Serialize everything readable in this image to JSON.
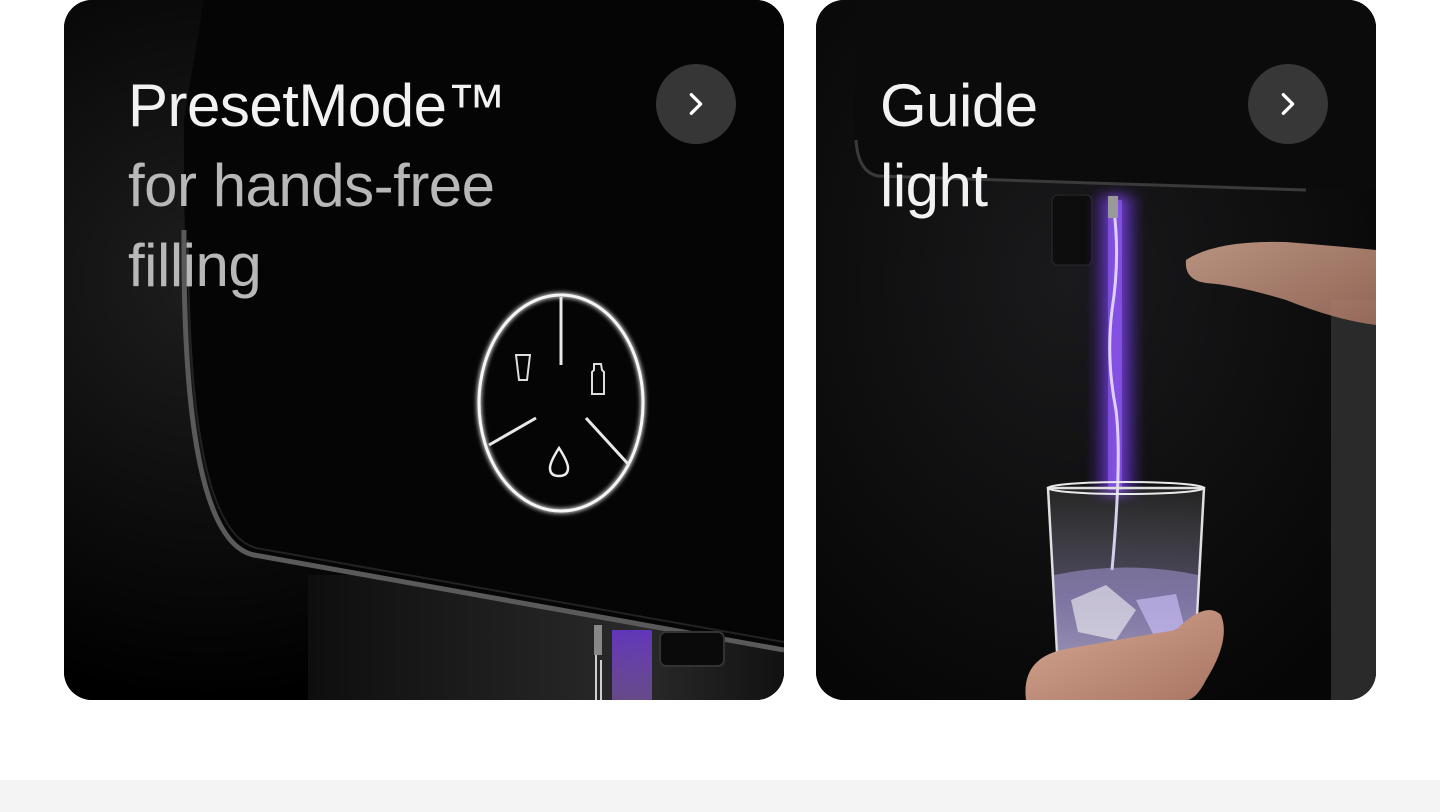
{
  "cards": [
    {
      "title_line1": "PresetMode™",
      "title_line2": "for hands-free",
      "title_line3": "filling",
      "button_icon": "chevron-right-icon"
    },
    {
      "title_line1": "Guide",
      "title_line2": "light",
      "button_icon": "chevron-right-icon"
    }
  ],
  "colors": {
    "card_background": "#000000",
    "title_text": "#f2f2f2",
    "title_muted_text": "#b8b8b8",
    "button_background": "#404040",
    "accent_purple": "#8a4dff",
    "page_background": "#ffffff",
    "bottom_band": "#f4f4f4"
  }
}
